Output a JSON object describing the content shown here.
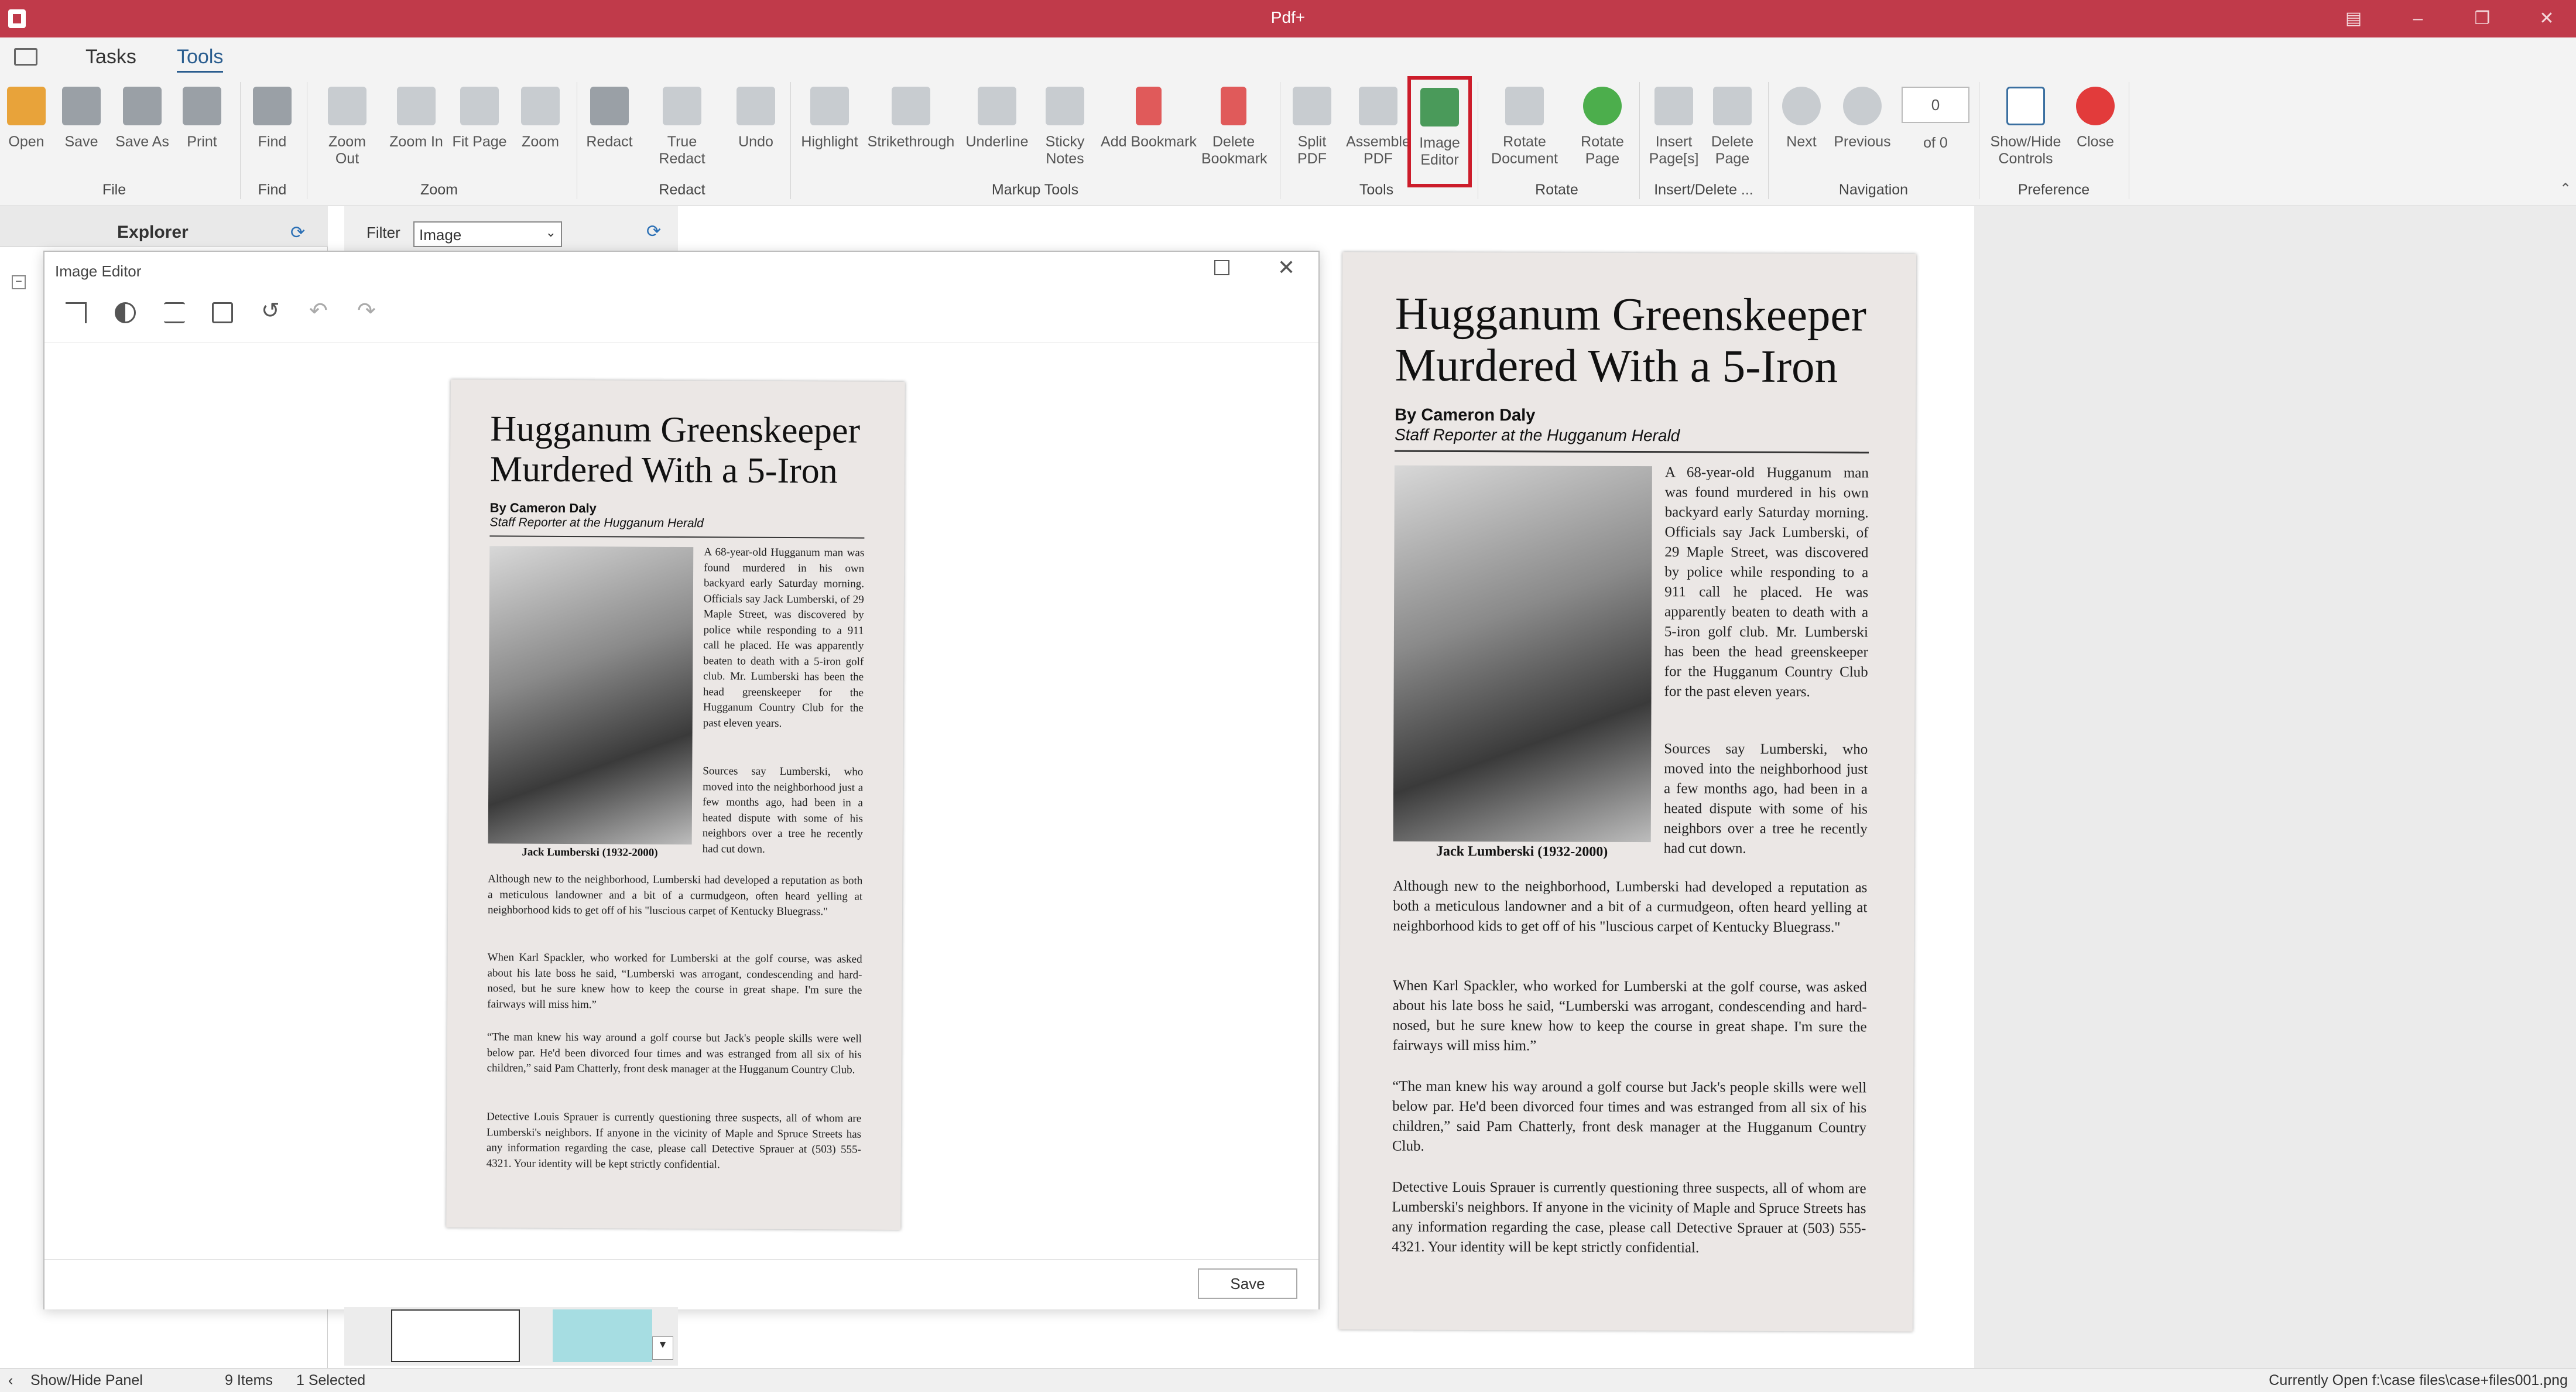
{
  "app": {
    "title": "Pdf+"
  },
  "menu": {
    "tabs": [
      "Tasks",
      "Tools"
    ],
    "active": "Tools"
  },
  "ribbon": {
    "file": {
      "open": "Open",
      "save": "Save",
      "save_as": "Save As",
      "print": "Print",
      "group": "File"
    },
    "find": {
      "find": "Find",
      "group": "Find"
    },
    "zoom": {
      "zoom_out": "Zoom Out",
      "zoom_in": "Zoom In",
      "fit_page": "Fit Page",
      "zoom": "Zoom",
      "group": "Zoom"
    },
    "redact": {
      "redact": "Redact",
      "true_redact": "True Redact",
      "undo": "Undo",
      "group": "Redact"
    },
    "markup": {
      "highlight": "Highlight",
      "strikethrough": "Strikethrough",
      "underline": "Underline",
      "sticky_l1": "Sticky",
      "sticky_l2": "Notes",
      "add_bookmark": "Add Bookmark",
      "del_bm_l1": "Delete",
      "del_bm_l2": "Bookmark",
      "group": "Markup Tools"
    },
    "tools": {
      "split_l1": "Split",
      "split_l2": "PDF",
      "assemble_l1": "Assemble",
      "assemble_l2": "PDF",
      "image_l1": "Image",
      "image_l2": "Editor",
      "group": "Tools"
    },
    "rotate": {
      "rotdoc_l1": "Rotate",
      "rotdoc_l2": "Document",
      "rotpage_l1": "Rotate",
      "rotpage_l2": "Page",
      "group": "Rotate"
    },
    "insdel": {
      "insert_l1": "Insert",
      "insert_l2": "Page[s]",
      "delete_l1": "Delete",
      "delete_l2": "Page",
      "group": "Insert/Delete ..."
    },
    "nav": {
      "next": "Next",
      "previous": "Previous",
      "page_value": "0",
      "of_total": "of 0",
      "group": "Navigation"
    },
    "pref": {
      "showhide_l1": "Show/Hide",
      "showhide_l2": "Controls",
      "close": "Close",
      "group": "Preference"
    }
  },
  "explorer": {
    "title": "Explorer",
    "filter_label": "Filter",
    "filter_value": "Image"
  },
  "dialog": {
    "title": "Image Editor",
    "save": "Save"
  },
  "article": {
    "headline_l1": "Hugganum Greenskeeper",
    "headline_l2": "Murdered With a 5-Iron",
    "byline": "By Cameron Daly",
    "staff": "Staff Reporter at the Hugganum Herald",
    "caption": "Jack Lumberski (1932-2000)",
    "p1": "A 68-year-old Hugganum man was found murdered in his own backyard early Saturday morning. Officials say Jack Lumberski, of 29 Maple Street, was discovered by police while responding to a 911 call he placed. He was apparently beaten to death with a 5-iron golf club. Mr. Lumberski has been the head greenskeeper for the Hugganum Country Club for the past eleven years.",
    "p2": "Sources say Lumberski, who moved into the neighborhood just a few months ago, had been in a heated dispute with some of his neighbors over a tree he recently had cut down.",
    "p3": "Although new to the neighborhood, Lumberski had developed a reputation as both a meticulous landowner and a bit of a curmudgeon, often heard yelling at neighborhood kids to get off of his \"luscious carpet of Kentucky Bluegrass.\"",
    "p4": "When Karl Spackler, who worked for Lumberski at the golf course, was asked about his late boss he said, “Lumberski was arrogant, condescending and hard-nosed, but he sure knew how to keep the course in great shape. I'm sure the fairways will miss him.”",
    "p5": "“The man knew his way around a golf course but Jack's people skills were well below par. He'd been divorced four times and was estranged from all six of his children,” said Pam Chatterly, front desk manager at the Hugganum Country Club.",
    "p6": "Detective Louis Sprauer is currently questioning three suspects, all of whom are Lumberski's neighbors. If anyone in the vicinity of Maple and Spruce Streets has any information regarding the case, please call Detective Sprauer at (503) 555-4321. Your identity will be kept strictly confidential."
  },
  "status": {
    "showhide": "Show/Hide Panel",
    "items": "9 Items",
    "selected": "1 Selected",
    "current": "Currently Open f:\\case files\\case+files001.png"
  },
  "colors": {
    "titlebar": "#c03a4a",
    "highlight_box": "#cc1c2a",
    "accent": "#2a5d8f"
  }
}
